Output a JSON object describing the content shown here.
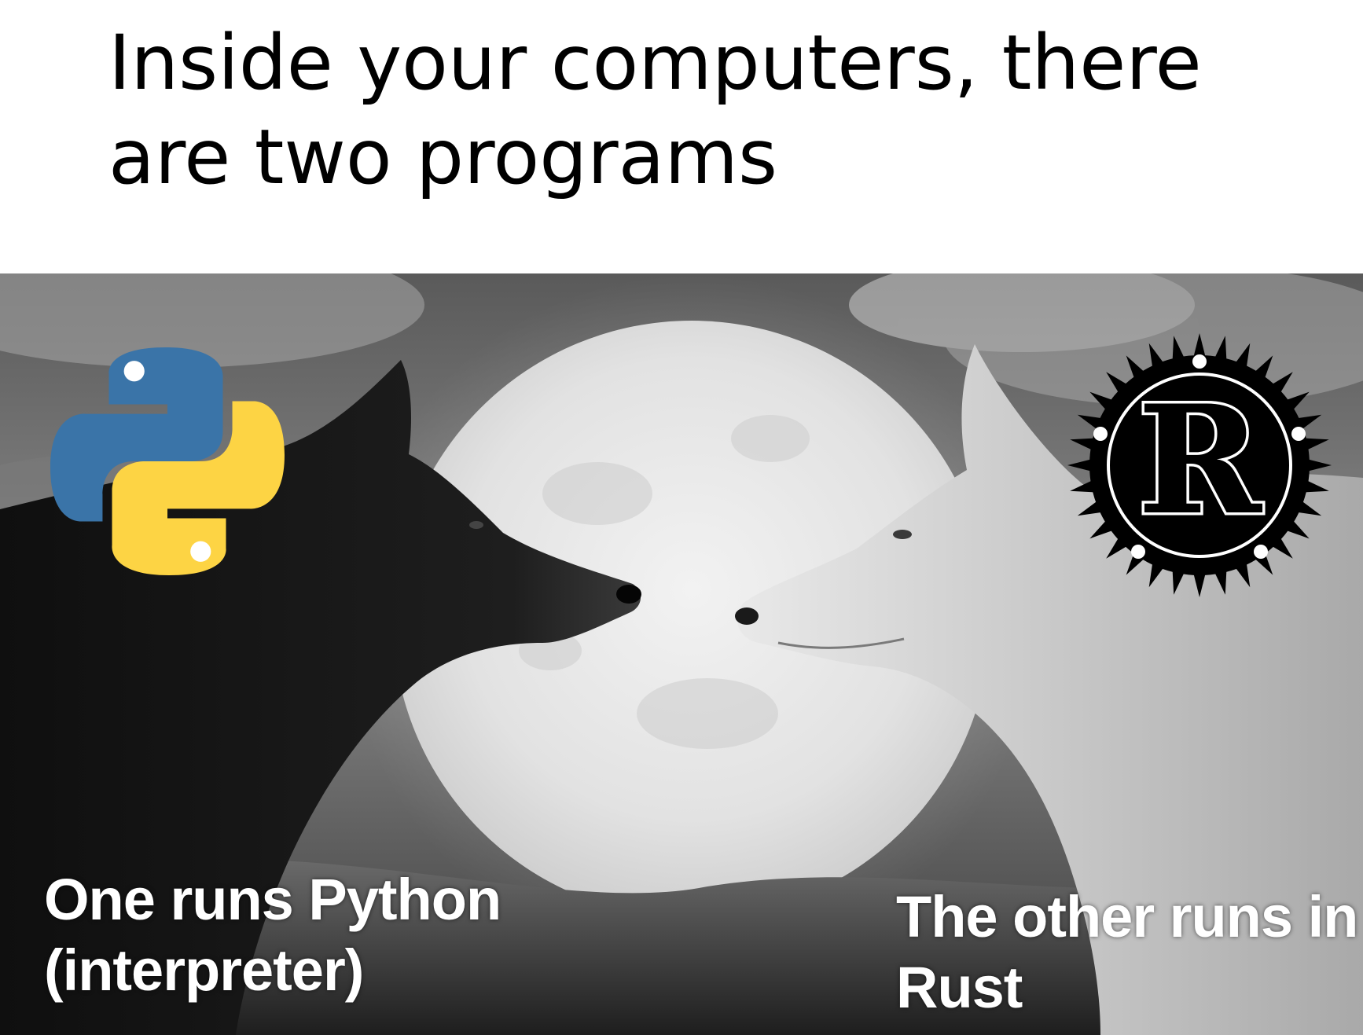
{
  "caption": {
    "text": "Inside your computers, there are two programs"
  },
  "labels": {
    "left": "One runs Python (interpreter)",
    "right": "The other runs in Rust"
  },
  "logos": {
    "left": "python-logo",
    "right": "rust-logo"
  },
  "colors": {
    "python_blue": "#3a74a8",
    "python_yellow": "#fdd444",
    "rust_black": "#000000",
    "label_text": "#ffffff",
    "caption_text": "#000000"
  }
}
